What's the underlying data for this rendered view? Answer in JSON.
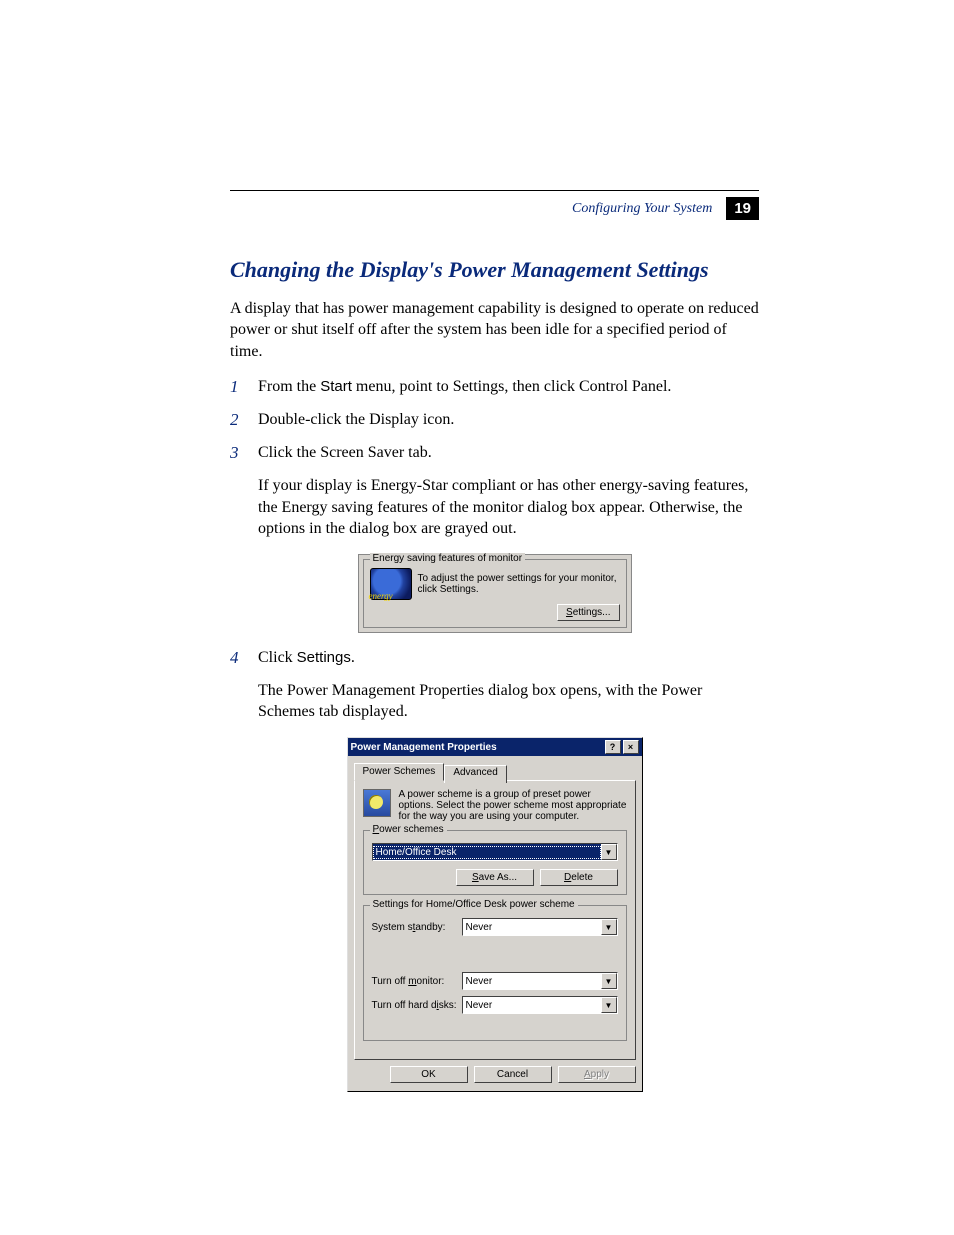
{
  "header": {
    "section": "Configuring Your System",
    "page_num": "19"
  },
  "title": "Changing the Display's Power Management Settings",
  "intro": "A display that has power management capability is designed to operate on reduced power or shut itself off after the system has been idle for a specified period of time.",
  "steps": [
    {
      "num": "1",
      "pre": "From the ",
      "strong": "Start",
      "post": " menu, point to Settings, then click Control Panel."
    },
    {
      "num": "2",
      "text": "Double-click the Display icon."
    },
    {
      "num": "3",
      "text": "Click the Screen Saver tab."
    }
  ],
  "step3_note": "If your display is Energy-Star compliant or has other energy-saving features, the Energy saving features of the monitor dialog box appear. Otherwise, the options in the dialog box are grayed out.",
  "shot1": {
    "group": "Energy saving features of monitor",
    "text": "To adjust the power settings for your monitor, click Settings.",
    "button": "Settings..."
  },
  "step4": {
    "num": "4",
    "pre": "Click ",
    "strong": "Settings",
    "post": "."
  },
  "step4_note": "The Power Management Properties dialog box opens, with the Power Schemes tab displayed.",
  "dialog": {
    "title": "Power Management Properties",
    "help": "?",
    "close": "×",
    "tabs": {
      "active": "Power Schemes",
      "other": "Advanced"
    },
    "description": "A power scheme is a group of preset power options. Select the power scheme most appropriate for the way you are using your computer.",
    "group_schemes": {
      "title": "Power schemes",
      "value": "Home/Office Desk",
      "save": "Save As...",
      "delete": "Delete"
    },
    "group_settings": {
      "title": "Settings for Home/Office Desk power scheme",
      "standby_label": "System standby:",
      "standby_value": "Never",
      "monitor_label": "Turn off monitor:",
      "monitor_value": "Never",
      "disks_label": "Turn off hard disks:",
      "disks_value": "Never"
    },
    "buttons": {
      "ok": "OK",
      "cancel": "Cancel",
      "apply": "Apply"
    }
  }
}
